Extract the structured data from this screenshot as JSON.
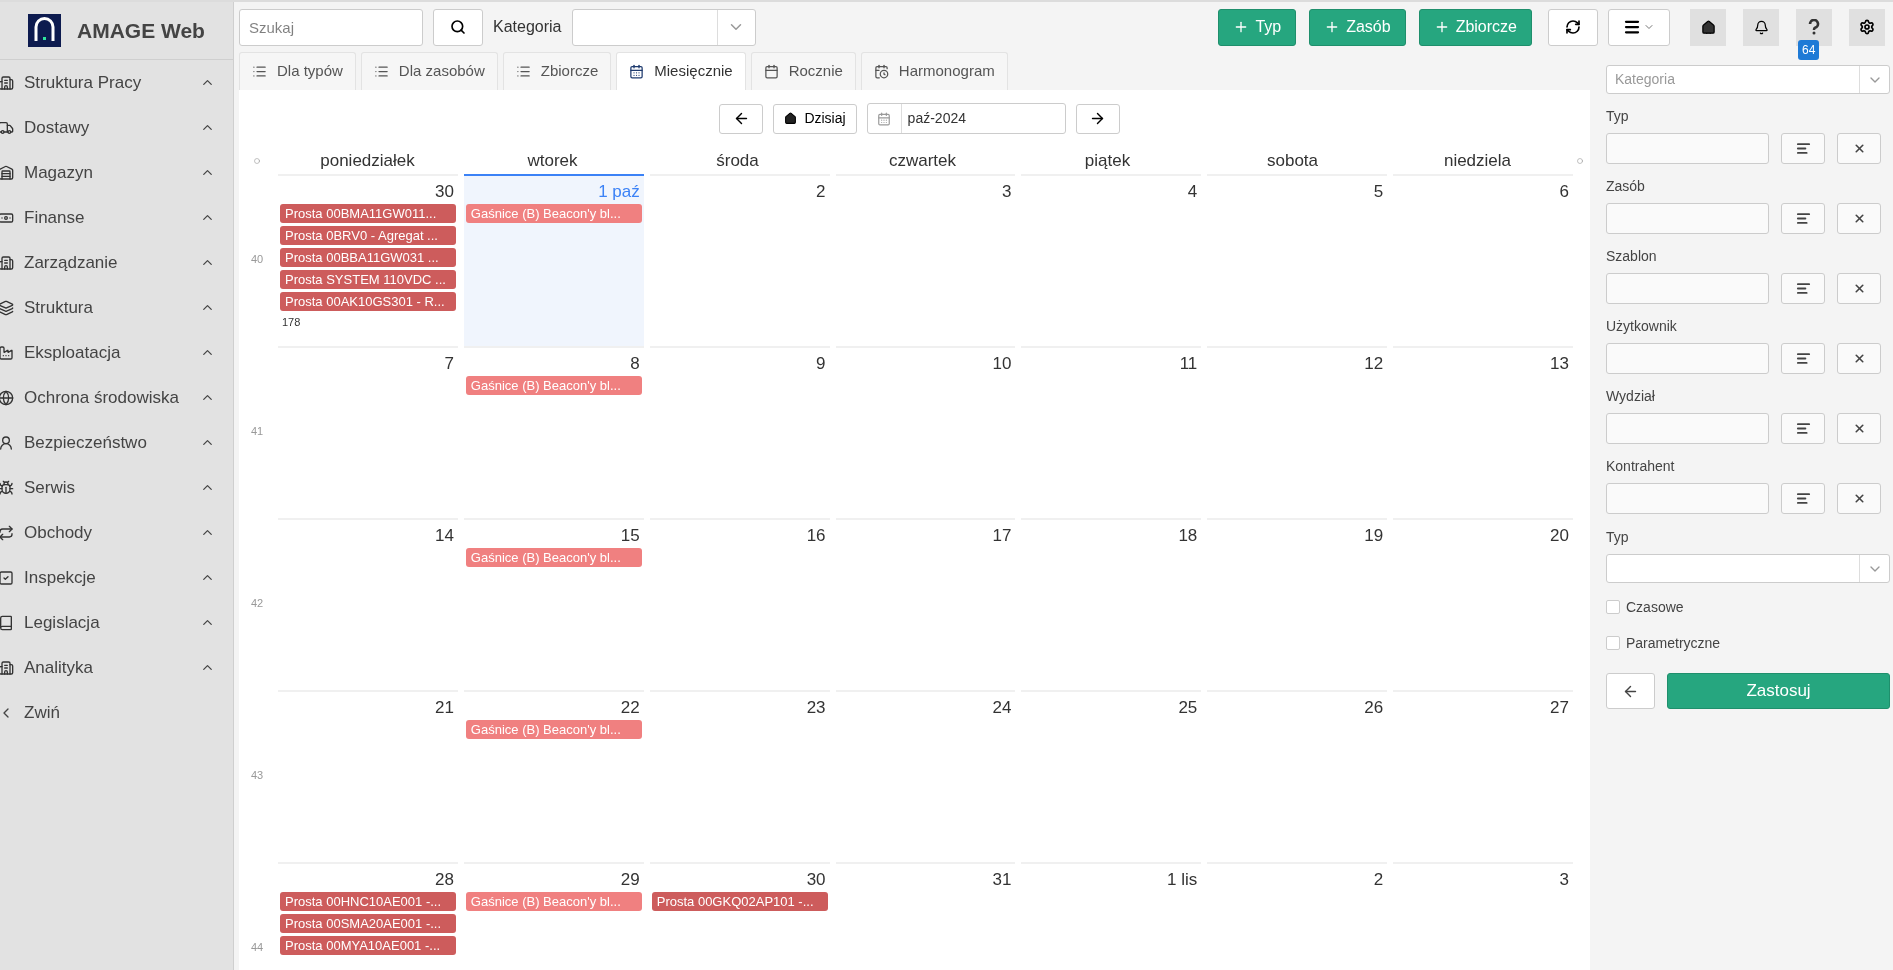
{
  "app": {
    "title": "AMAGE Web"
  },
  "sidebar": {
    "items": [
      {
        "label": "Struktura Pracy",
        "expanded": false
      },
      {
        "label": "Dostawy",
        "expanded": false
      },
      {
        "label": "Magazyn",
        "expanded": false
      },
      {
        "label": "Finanse",
        "expanded": false
      },
      {
        "label": "Zarządzanie",
        "expanded": false
      },
      {
        "label": "Struktura",
        "expanded": false
      },
      {
        "label": "Eksploatacja",
        "expanded": false
      },
      {
        "label": "Ochrona środowiska",
        "expanded": false
      },
      {
        "label": "Bezpieczeństwo",
        "expanded": false
      },
      {
        "label": "Serwis",
        "expanded": false
      },
      {
        "label": "Obchody",
        "expanded": false
      },
      {
        "label": "Inspekcje",
        "expanded": false
      },
      {
        "label": "Legislacja",
        "expanded": false
      },
      {
        "label": "Analityka",
        "expanded": false
      }
    ],
    "collapse": "Zwiń"
  },
  "toolbar": {
    "search": {
      "placeholder": "Szukaj"
    },
    "category_label": "Kategoria",
    "add_buttons": [
      "Typ",
      "Zasób",
      "Zbiorcze"
    ],
    "help_badge": "64"
  },
  "tabs": [
    {
      "label": "Dla typów",
      "selected": false
    },
    {
      "label": "Dla zasobów",
      "selected": false
    },
    {
      "label": "Zbiorcze",
      "selected": false
    },
    {
      "label": "Miesięcznie",
      "selected": true
    },
    {
      "label": "Rocznie",
      "selected": false
    },
    {
      "label": "Harmonogram",
      "selected": false
    }
  ],
  "calendar": {
    "today_button": "Dzisiaj",
    "month": "paź-2024",
    "weekdays": [
      "poniedziałek",
      "wtorek",
      "środa",
      "czwartek",
      "piątek",
      "sobota",
      "niedziela"
    ],
    "weeks": [
      {
        "number": "40",
        "days": [
          {
            "date": "30",
            "today": false,
            "events": [
              {
                "text": "Prosta 00BMA11GW011...",
                "color": "#cd5c5c"
              },
              {
                "text": "Prosta 0BRV0 - Agregat ...",
                "color": "#cd5c5c"
              },
              {
                "text": "Prosta 00BBA11GW031 ...",
                "color": "#cd5c5c"
              },
              {
                "text": "Prosta SYSTEM 110VDC ...",
                "color": "#cd5c5c"
              },
              {
                "text": "Prosta 00AK10GS301 - R...",
                "color": "#cd5c5c"
              }
            ],
            "more": "178"
          },
          {
            "date": "1 paź",
            "today": true,
            "events": [
              {
                "text": "Gaśnice (B) Beacon'y bl...",
                "color": "#f08080"
              }
            ]
          },
          {
            "date": "2",
            "today": false
          },
          {
            "date": "3",
            "today": false
          },
          {
            "date": "4",
            "today": false
          },
          {
            "date": "5",
            "today": false
          },
          {
            "date": "6",
            "today": false
          }
        ]
      },
      {
        "number": "41",
        "days": [
          {
            "date": "7",
            "today": false
          },
          {
            "date": "8",
            "today": false,
            "events": [
              {
                "text": "Gaśnice (B) Beacon'y bl...",
                "color": "#f08080"
              }
            ]
          },
          {
            "date": "9",
            "today": false
          },
          {
            "date": "10",
            "today": false
          },
          {
            "date": "11",
            "today": false
          },
          {
            "date": "12",
            "today": false
          },
          {
            "date": "13",
            "today": false
          }
        ]
      },
      {
        "number": "42",
        "days": [
          {
            "date": "14",
            "today": false
          },
          {
            "date": "15",
            "today": false,
            "events": [
              {
                "text": "Gaśnice (B) Beacon'y bl...",
                "color": "#f08080"
              }
            ]
          },
          {
            "date": "16",
            "today": false
          },
          {
            "date": "17",
            "today": false
          },
          {
            "date": "18",
            "today": false
          },
          {
            "date": "19",
            "today": false
          },
          {
            "date": "20",
            "today": false
          }
        ]
      },
      {
        "number": "43",
        "days": [
          {
            "date": "21",
            "today": false
          },
          {
            "date": "22",
            "today": false,
            "events": [
              {
                "text": "Gaśnice (B) Beacon'y bl...",
                "color": "#f08080"
              }
            ]
          },
          {
            "date": "23",
            "today": false
          },
          {
            "date": "24",
            "today": false
          },
          {
            "date": "25",
            "today": false
          },
          {
            "date": "26",
            "today": false
          },
          {
            "date": "27",
            "today": false
          }
        ]
      },
      {
        "number": "44",
        "days": [
          {
            "date": "28",
            "today": false,
            "events": [
              {
                "text": "Prosta 00HNC10AE001 -...",
                "color": "#cd5c5c"
              },
              {
                "text": "Prosta 00SMA20AE001 -...",
                "color": "#cd5c5c"
              },
              {
                "text": "Prosta 00MYA10AE001 -...",
                "color": "#cd5c5c"
              }
            ]
          },
          {
            "date": "29",
            "today": false,
            "events": [
              {
                "text": "Gaśnice (B) Beacon'y bl...",
                "color": "#f08080"
              }
            ]
          },
          {
            "date": "30",
            "today": false,
            "events": [
              {
                "text": "Prosta 00GKQ02AP101 -...",
                "color": "#cd5c5c"
              }
            ]
          },
          {
            "date": "31",
            "today": false
          },
          {
            "date": "1 lis",
            "today": false
          },
          {
            "date": "2",
            "today": false
          },
          {
            "date": "3",
            "today": false
          }
        ]
      }
    ]
  },
  "filters": {
    "category_placeholder": "Kategoria",
    "fields": [
      {
        "label": "Typ"
      },
      {
        "label": "Zasób"
      },
      {
        "label": "Szablon"
      },
      {
        "label": "Użytkownik"
      },
      {
        "label": "Wydział"
      },
      {
        "label": "Kontrahent"
      }
    ],
    "type_label": "Typ",
    "checkboxes": [
      {
        "label": "Czasowe",
        "checked": false
      },
      {
        "label": "Parametryczne",
        "checked": false
      }
    ],
    "apply": "Zastosuj"
  }
}
